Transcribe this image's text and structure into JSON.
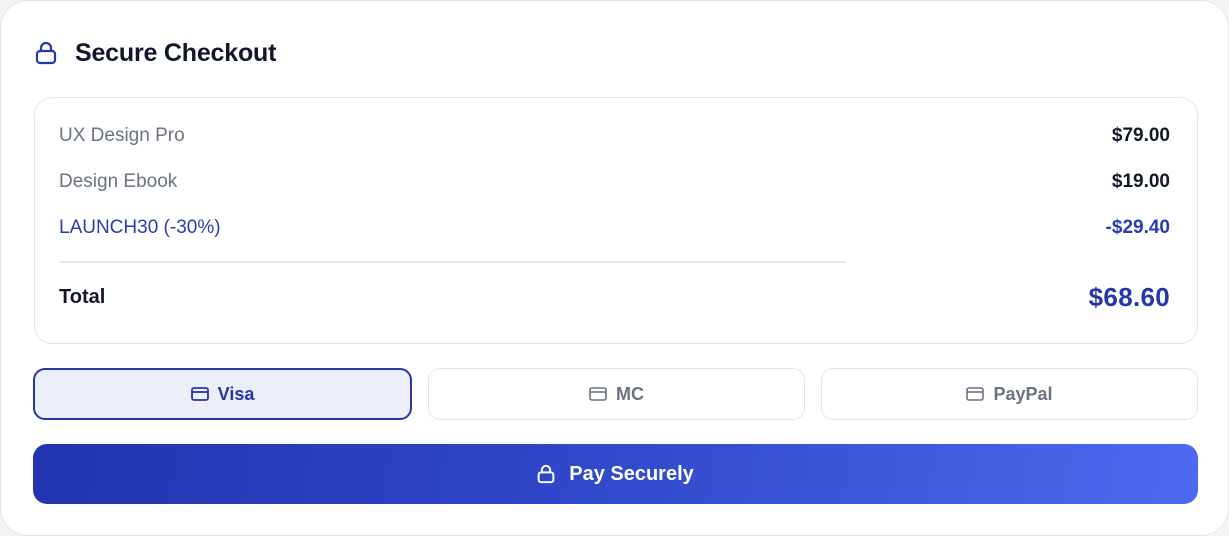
{
  "header": {
    "title": "Secure Checkout",
    "icon": "lock-icon"
  },
  "summary": {
    "items": [
      {
        "label": "UX Design Pro",
        "amount": "$79.00"
      },
      {
        "label": "Design Ebook",
        "amount": "$19.00"
      }
    ],
    "discount": {
      "label": "LAUNCH30 (-30%)",
      "amount": "-$29.40"
    },
    "total": {
      "label": "Total",
      "amount": "$68.60"
    }
  },
  "payment_methods": [
    {
      "label": "Visa",
      "icon": "credit-card-icon",
      "selected": true
    },
    {
      "label": "MC",
      "icon": "credit-card-icon",
      "selected": false
    },
    {
      "label": "PayPal",
      "icon": "credit-card-icon",
      "selected": false
    }
  ],
  "pay_button": {
    "label": "Pay Securely",
    "icon": "lock-icon"
  },
  "colors": {
    "accent": "#2536a8",
    "accent_bg": "#eceef8",
    "gradient_start": "#2233b0",
    "gradient_end": "#4d6af0"
  }
}
